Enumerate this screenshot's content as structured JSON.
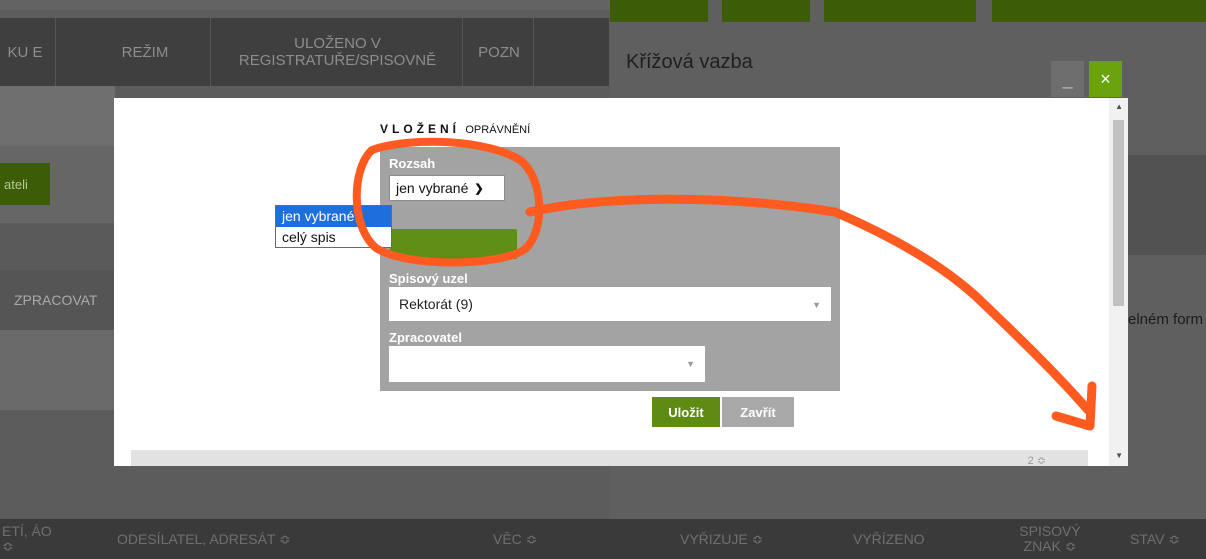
{
  "background": {
    "header_columns": [
      "KU E",
      "REŽIM",
      "ULOŽENO V REGISTRATUŘE/SPISOVNĚ",
      "POZN"
    ],
    "side_button": "ateli",
    "side_label": "ZPRACOVAT",
    "right_panel_title": "Křížová vazba",
    "right_panel_text": "elném form",
    "window_buttons": {
      "minimize": "_",
      "close": "×"
    },
    "footer_columns": [
      "ETÍ, ÁO ≎",
      "ODESÍLATEL, ADRESÁT ≎",
      "VĚC ≎",
      "VYŘIZUJE ≎",
      "VYŘÍZENO",
      "SPISOVÝ ZNAK ≎",
      "STAV ≎"
    ]
  },
  "modal": {
    "heading_main": "VLOŽENÍ",
    "heading_sub": "OPRÁVNĚNÍ",
    "rozsah": {
      "label": "Rozsah",
      "selected": "jen vybrané",
      "options": [
        "jen vybrané",
        "celý spis"
      ]
    },
    "spisovy_uzel": {
      "label": "Spisový uzel",
      "value": "Rektorát (9)"
    },
    "zpracovatel": {
      "label": "Zpracovatel",
      "value": ""
    },
    "buttons": {
      "save": "Uložit",
      "close": "Zavřít"
    },
    "bottom_bar_text": "2 ≎"
  },
  "colors": {
    "accent_green": "#5e8c12",
    "annotation": "#ff5a1f",
    "selected_option": "#1e6fde"
  }
}
